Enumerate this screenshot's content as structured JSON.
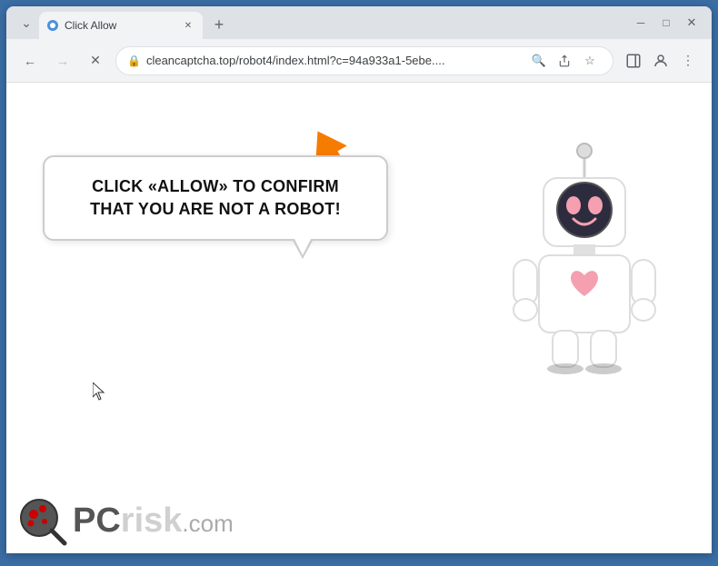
{
  "browser": {
    "tab": {
      "title": "Click Allow",
      "favicon": "🌐"
    },
    "window_controls": {
      "minimize": "─",
      "maximize": "□",
      "close": "✕",
      "chevron_down": "⌄"
    },
    "address_bar": {
      "url": "cleancaptcha.top/robot4/index.html?c=94a933a1-5ebe....",
      "lock_icon": "🔒"
    },
    "nav": {
      "back": "←",
      "forward": "→",
      "reload": "✕"
    }
  },
  "page": {
    "bubble_text": "CLICK «ALLOW» TO CONFIRM THAT YOU ARE NOT A ROBOT!",
    "pcrisk": {
      "pc_text": "PC",
      "risk_text": "risk",
      "dotcom": ".com"
    }
  }
}
